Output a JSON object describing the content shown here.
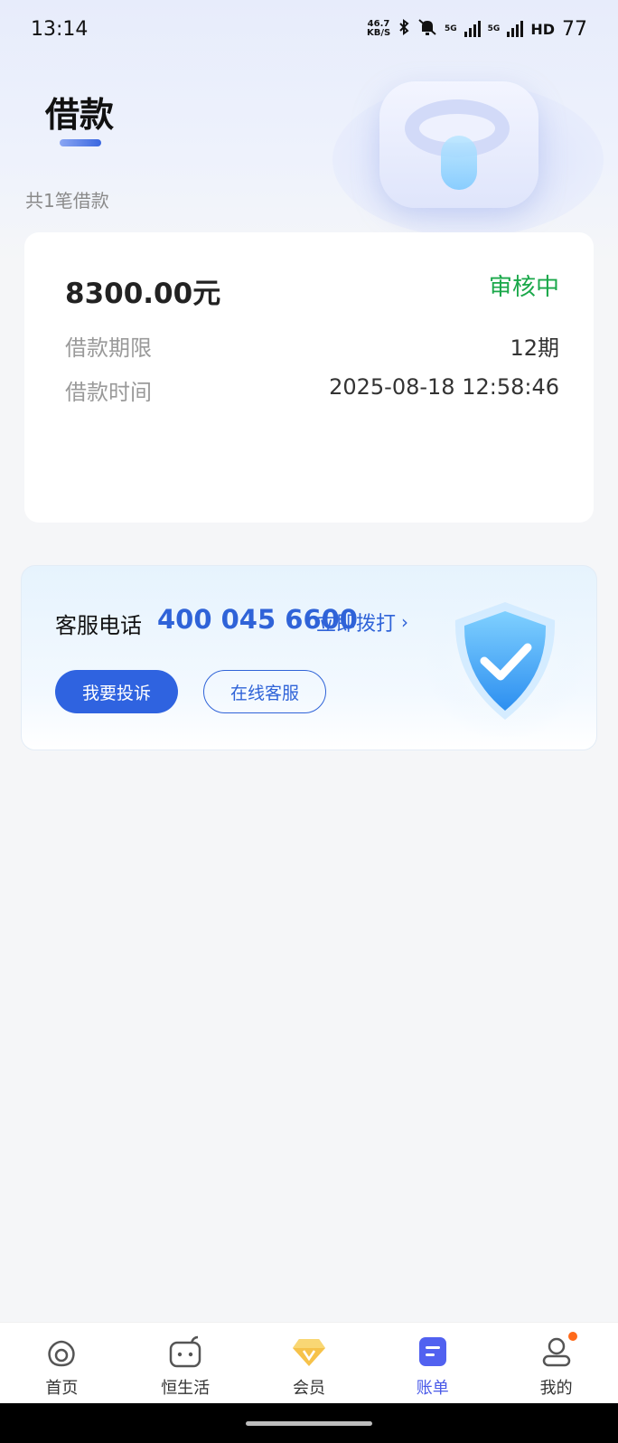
{
  "status_bar": {
    "time": "13:14",
    "net_speed_value": "46.7",
    "net_speed_unit": "KB/S",
    "network_label_1": "5G",
    "network_label_2": "5G",
    "hd_label": "HD",
    "battery": "77"
  },
  "page": {
    "title": "借款",
    "loan_count": "共1笔借款"
  },
  "loan_card": {
    "amount": "8300.00元",
    "status": "审核中",
    "term_label": "借款期限",
    "term_value": "12期",
    "time_label": "借款时间",
    "time_value": "2025-08-18 12:58:46"
  },
  "service": {
    "label": "客服电话",
    "phone": "400 045 6600",
    "call_label": "立即拨打",
    "complaint_button": "我要投诉",
    "online_button": "在线客服"
  },
  "tabs": [
    {
      "label": "首页",
      "icon": "home-bag-icon"
    },
    {
      "label": "恒生活",
      "icon": "life-box-icon"
    },
    {
      "label": "会员",
      "icon": "diamond-icon"
    },
    {
      "label": "账单",
      "icon": "bill-icon",
      "active": true
    },
    {
      "label": "我的",
      "icon": "profile-icon",
      "badge": true
    }
  ],
  "colors": {
    "accent": "#2f63e0",
    "status_green": "#1aa84a",
    "active_tab": "#4a5ae8",
    "badge_dot": "#ff6a1a"
  }
}
